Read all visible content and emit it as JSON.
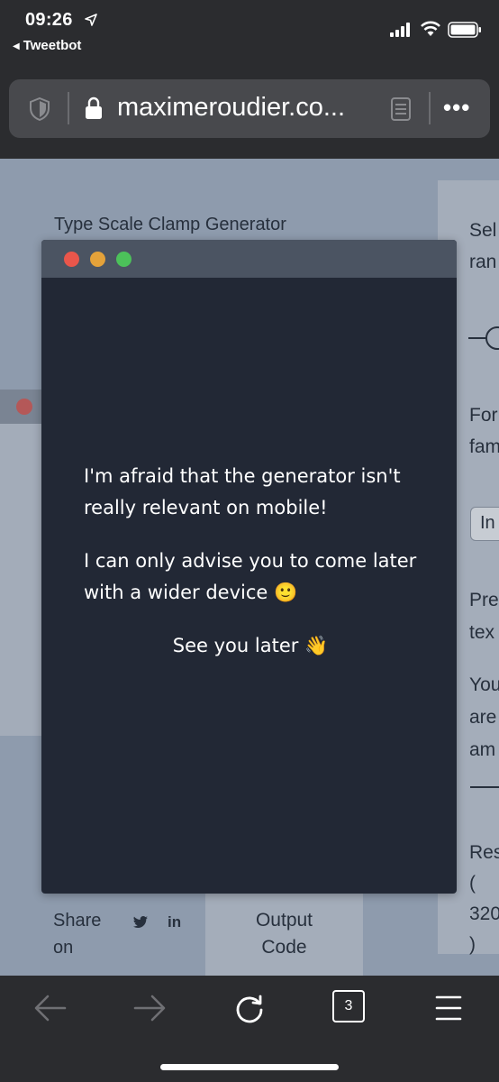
{
  "status": {
    "time": "09:26",
    "back_app": "Tweetbot"
  },
  "browser": {
    "url": "maximeroudier.co...",
    "tab_count": "3"
  },
  "background_page": {
    "title": "Type Scale Clamp Generator",
    "right_column": [
      "Sel",
      "ran",
      "For",
      "fam",
      "In",
      "Pre",
      "tex",
      "You",
      "are",
      "am",
      "Res",
      "(",
      "320",
      ")"
    ],
    "share_label": "Share on",
    "share_line1": "Share",
    "share_line2": "on",
    "linkedin_label": "in",
    "output_line1": "Output",
    "output_line2": "Code"
  },
  "modal": {
    "line1": "I'm afraid that the generator isn't really relevant on mobile!",
    "line2": "I can only advise you to come later with a wider device 🙂",
    "line3": "See you later 👋"
  },
  "colors": {
    "modal_bg": "#222835",
    "modal_bar": "#4b5462",
    "page_bg": "#8e9bad",
    "traffic_red": "#e9564b",
    "traffic_yellow": "#e4a23a",
    "traffic_green": "#4cc15a"
  },
  "icons": [
    "location-arrow-icon",
    "signal-icon",
    "wifi-icon",
    "battery-icon",
    "shield-icon",
    "lock-icon",
    "reader-icon",
    "more-icon",
    "back-icon",
    "forward-icon",
    "reload-icon",
    "menu-icon",
    "twitter-icon",
    "linkedin-icon"
  ]
}
